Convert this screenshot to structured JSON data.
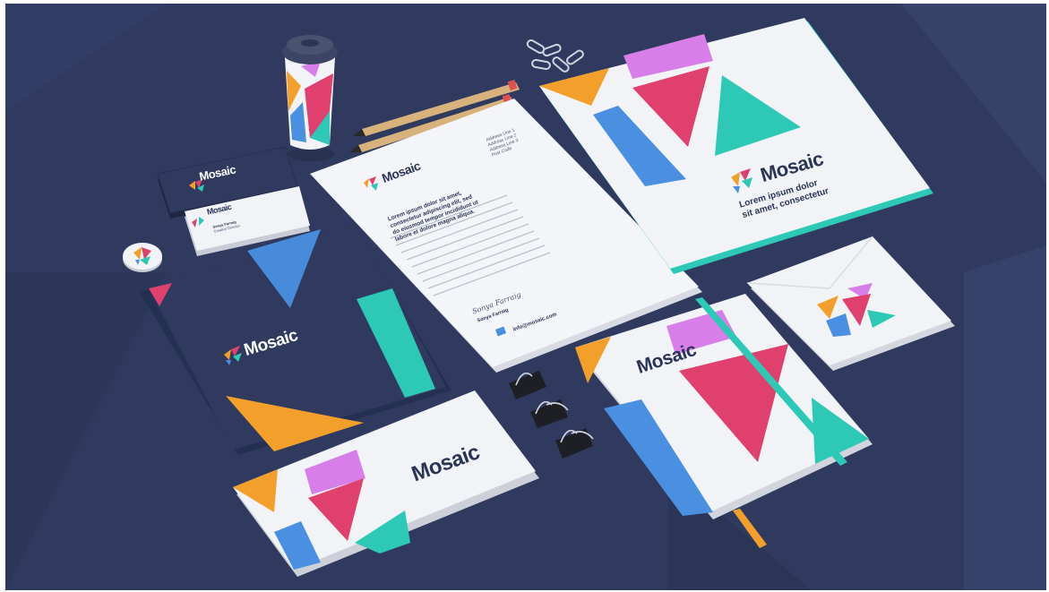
{
  "brand": {
    "name": "Mosaic",
    "tagline_line1": "Lorem ipsum dolor",
    "tagline_line2": "sit amet, consectetur",
    "colors": {
      "navy": "#2f3a5e",
      "orange": "#f2a02b",
      "pink": "#e0406e",
      "teal": "#2ec8b6",
      "blue": "#4a8fe0",
      "violet": "#d77ee8",
      "paper": "#f2f3f6"
    }
  },
  "letterhead": {
    "address": [
      "Address Line 1",
      "Address Line 2",
      "Address Line 3",
      "Post Code"
    ],
    "heading": [
      "Lorem ipsum dolor sit amet,",
      "consectetur adipiscing elit, sed",
      "do eiusmod tempor incididunt ut",
      "labore et dolore magna aliqua."
    ],
    "signature": "Sonya Farraig",
    "signer_name": "Sonya Farraig",
    "email": "info@mosaic.com"
  },
  "business_card": {
    "person_name": "Sonya Farraig",
    "person_title": "Creative Director"
  }
}
